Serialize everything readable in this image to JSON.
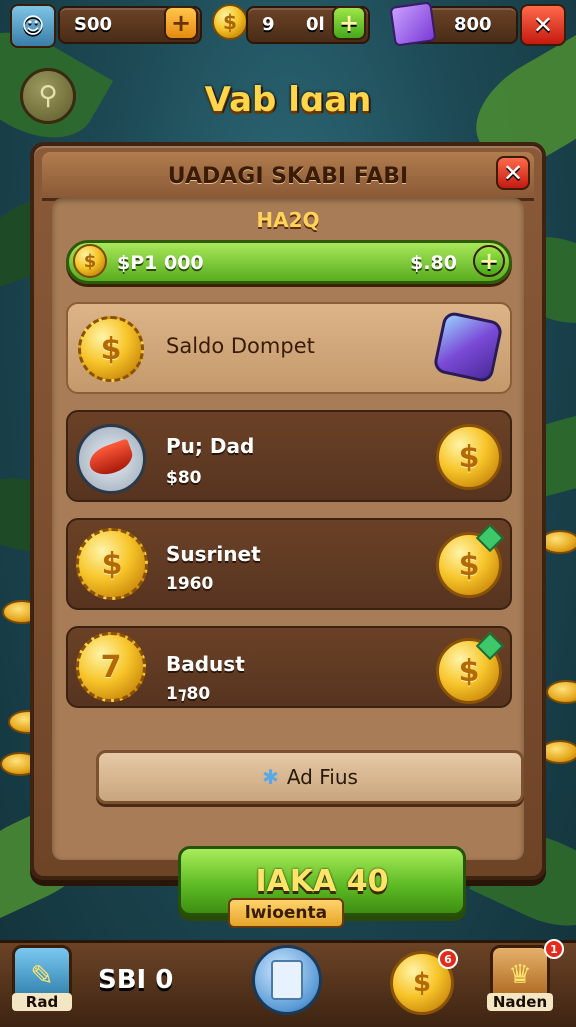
{
  "topbar": {
    "resource_1_value": "S00",
    "resource_2_left": "9",
    "resource_2_right": "0l",
    "resource_3_value": "800"
  },
  "game_title": "Vab lɑan",
  "panel": {
    "title": "UADAGI SKABI FABI",
    "subtitle": "HA2Q",
    "balance_left": "$P1 000",
    "balance_right": "$.80",
    "wallet_label": "Saldo Dompet",
    "items": [
      {
        "name": "Pu; Dad",
        "value": "$80",
        "icon": "rooster-badge-icon"
      },
      {
        "name": "Susrinet",
        "value": "1960",
        "icon": "dollar-gear-coin-icon"
      },
      {
        "name": "Badust",
        "value": "1⁊80",
        "icon": "seven-coin-icon"
      }
    ],
    "ad_button_label": "Ad Fius",
    "main_button_label": "IAKA 40"
  },
  "tag_label": "lwioenta",
  "bottombar": {
    "left_label": "Rad",
    "score": "SBI 0",
    "right_label": "Naden",
    "coin_badge": "6",
    "right_badge": "1"
  },
  "colors": {
    "accent_gold": "#ffd54a",
    "panel_brown": "#8a5a38",
    "button_green": "#5ab822",
    "close_red": "#c41a10"
  }
}
